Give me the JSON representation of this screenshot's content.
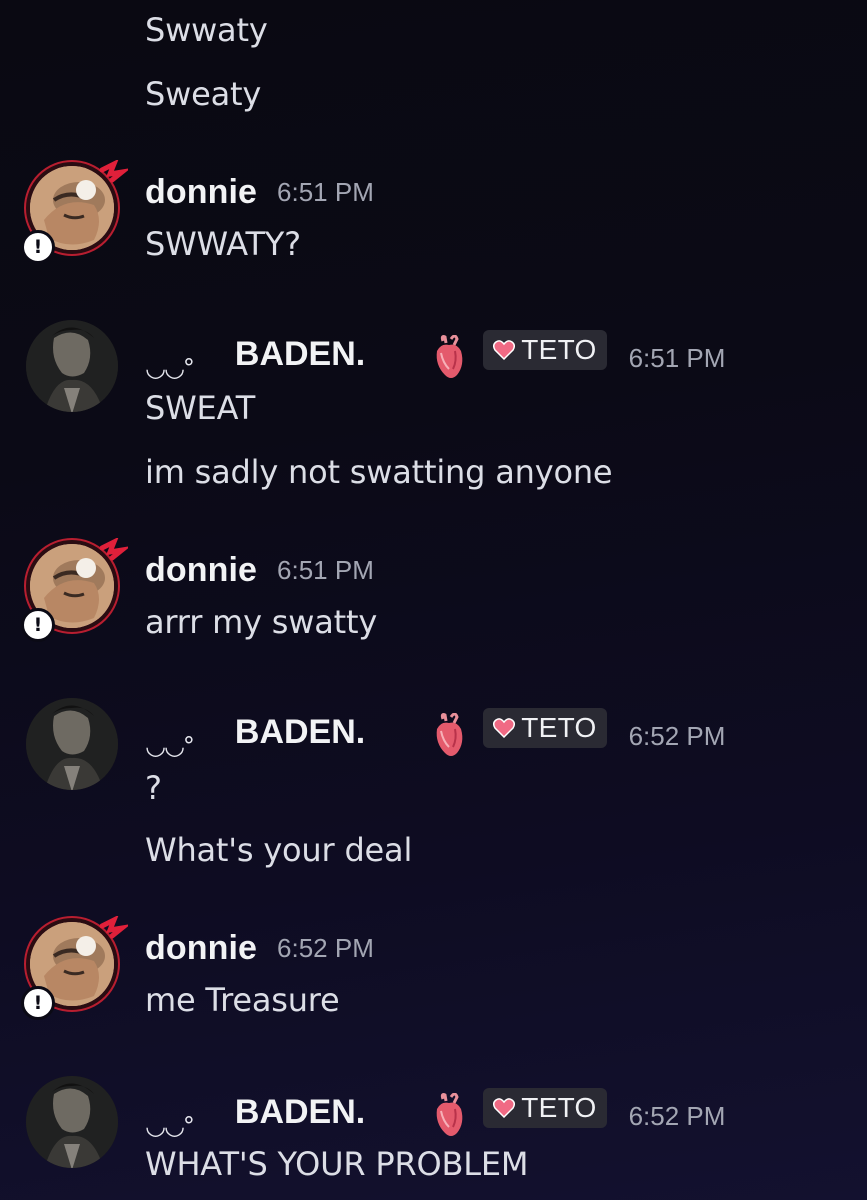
{
  "colors": {
    "background": "#0b0a16",
    "username": "#f2f3f5",
    "timestamp": "#a3a6b3",
    "message_text": "#dcdee6",
    "role_tag_bg": "#2a2a33",
    "role_heart": "#e85a72"
  },
  "continuation": {
    "lines": [
      "Swwaty",
      "Sweaty"
    ]
  },
  "messages": [
    {
      "author": "donnie",
      "time": "6:51 PM",
      "lines": [
        "SWWATY?"
      ],
      "avatar_icon": "donnie-avatar-icon",
      "status_icon": "exclamation-badge-icon"
    },
    {
      "author_prefix": "◡◡°",
      "author": "BADEN.",
      "emoji_icon": "anatomical-heart-icon",
      "role_icon": "pink-heart-icon",
      "role": "TETO",
      "time": "6:51 PM",
      "lines": [
        "SWEAT",
        "im sadly not swatting anyone"
      ]
    },
    {
      "author": "donnie",
      "time": "6:51 PM",
      "lines": [
        "arrr my swatty"
      ]
    },
    {
      "author_prefix": "◡◡°",
      "author": "BADEN.",
      "role": "TETO",
      "time": "6:52 PM",
      "lines": [
        "?",
        "What's your deal"
      ]
    },
    {
      "author": "donnie",
      "time": "6:52 PM",
      "lines": [
        "me Treasure"
      ]
    },
    {
      "author_prefix": "◡◡°",
      "author": "BADEN.",
      "role": "TETO",
      "time": "6:52 PM",
      "lines": [
        "WHAT'S YOUR PROBLEM"
      ]
    }
  ]
}
